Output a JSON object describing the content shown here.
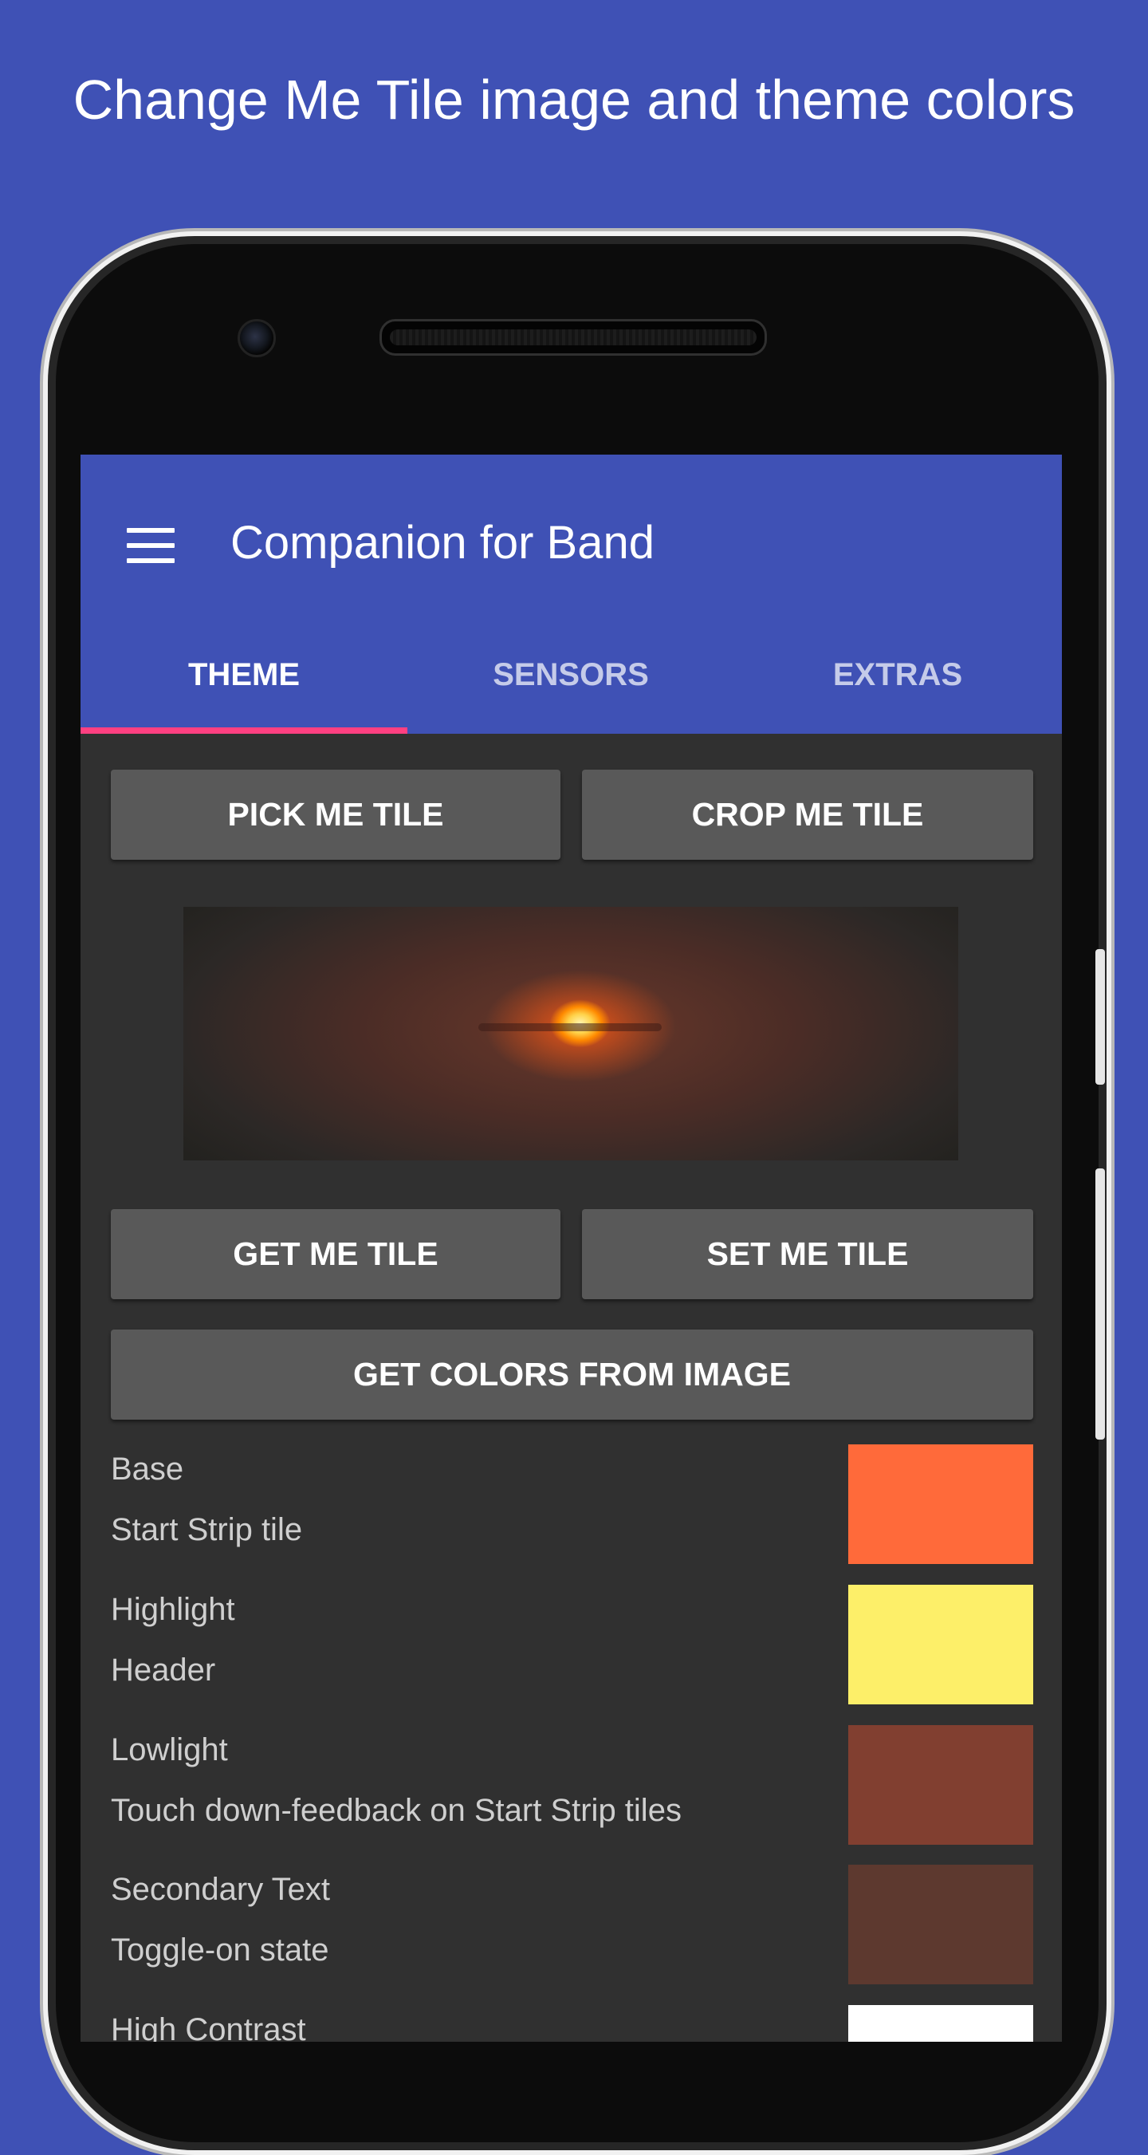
{
  "caption": "Change Me Tile image and theme colors",
  "app": {
    "title": "Companion for Band",
    "menu_icon": "hamburger-menu-icon",
    "accent": "#ff4081",
    "primary": "#3f51b5"
  },
  "tabs": [
    {
      "label": "THEME",
      "active": true
    },
    {
      "label": "SENSORS",
      "active": false
    },
    {
      "label": "EXTRAS",
      "active": false
    }
  ],
  "buttons": {
    "pick": "PICK ME TILE",
    "crop": "CROP ME TILE",
    "get": "GET ME TILE",
    "set": "SET ME TILE",
    "get_colors": "GET COLORS FROM IMAGE"
  },
  "colors": [
    {
      "name": "Base",
      "description": "Start Strip tile",
      "color": "#ff6a3a"
    },
    {
      "name": "Highlight",
      "description": "Header",
      "color": "#fdef69"
    },
    {
      "name": "Lowlight",
      "description": "Touch down-feedback on Start Strip tiles",
      "color": "#813f30"
    },
    {
      "name": "Secondary Text",
      "description": "Toggle-on state",
      "color": "#5d392f"
    },
    {
      "name": "High Contrast",
      "description": "",
      "color": "#ffffff"
    }
  ]
}
